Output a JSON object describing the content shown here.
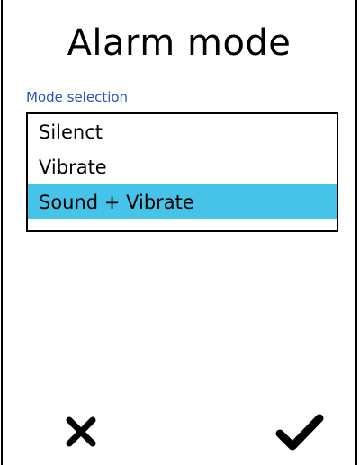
{
  "screen": {
    "title": "Alarm mode"
  },
  "mode_selection": {
    "label": "Mode selection",
    "options": [
      {
        "label": "Silenct",
        "selected": false
      },
      {
        "label": "Vibrate",
        "selected": false
      },
      {
        "label": "Sound + Vibrate",
        "selected": true
      }
    ],
    "selected_color": "#45c3e8"
  },
  "actions": {
    "cancel_icon": "close-icon",
    "confirm_icon": "checkmark-icon"
  },
  "colors": {
    "label": "#2a52be",
    "text": "#000000",
    "background": "#ffffff"
  }
}
